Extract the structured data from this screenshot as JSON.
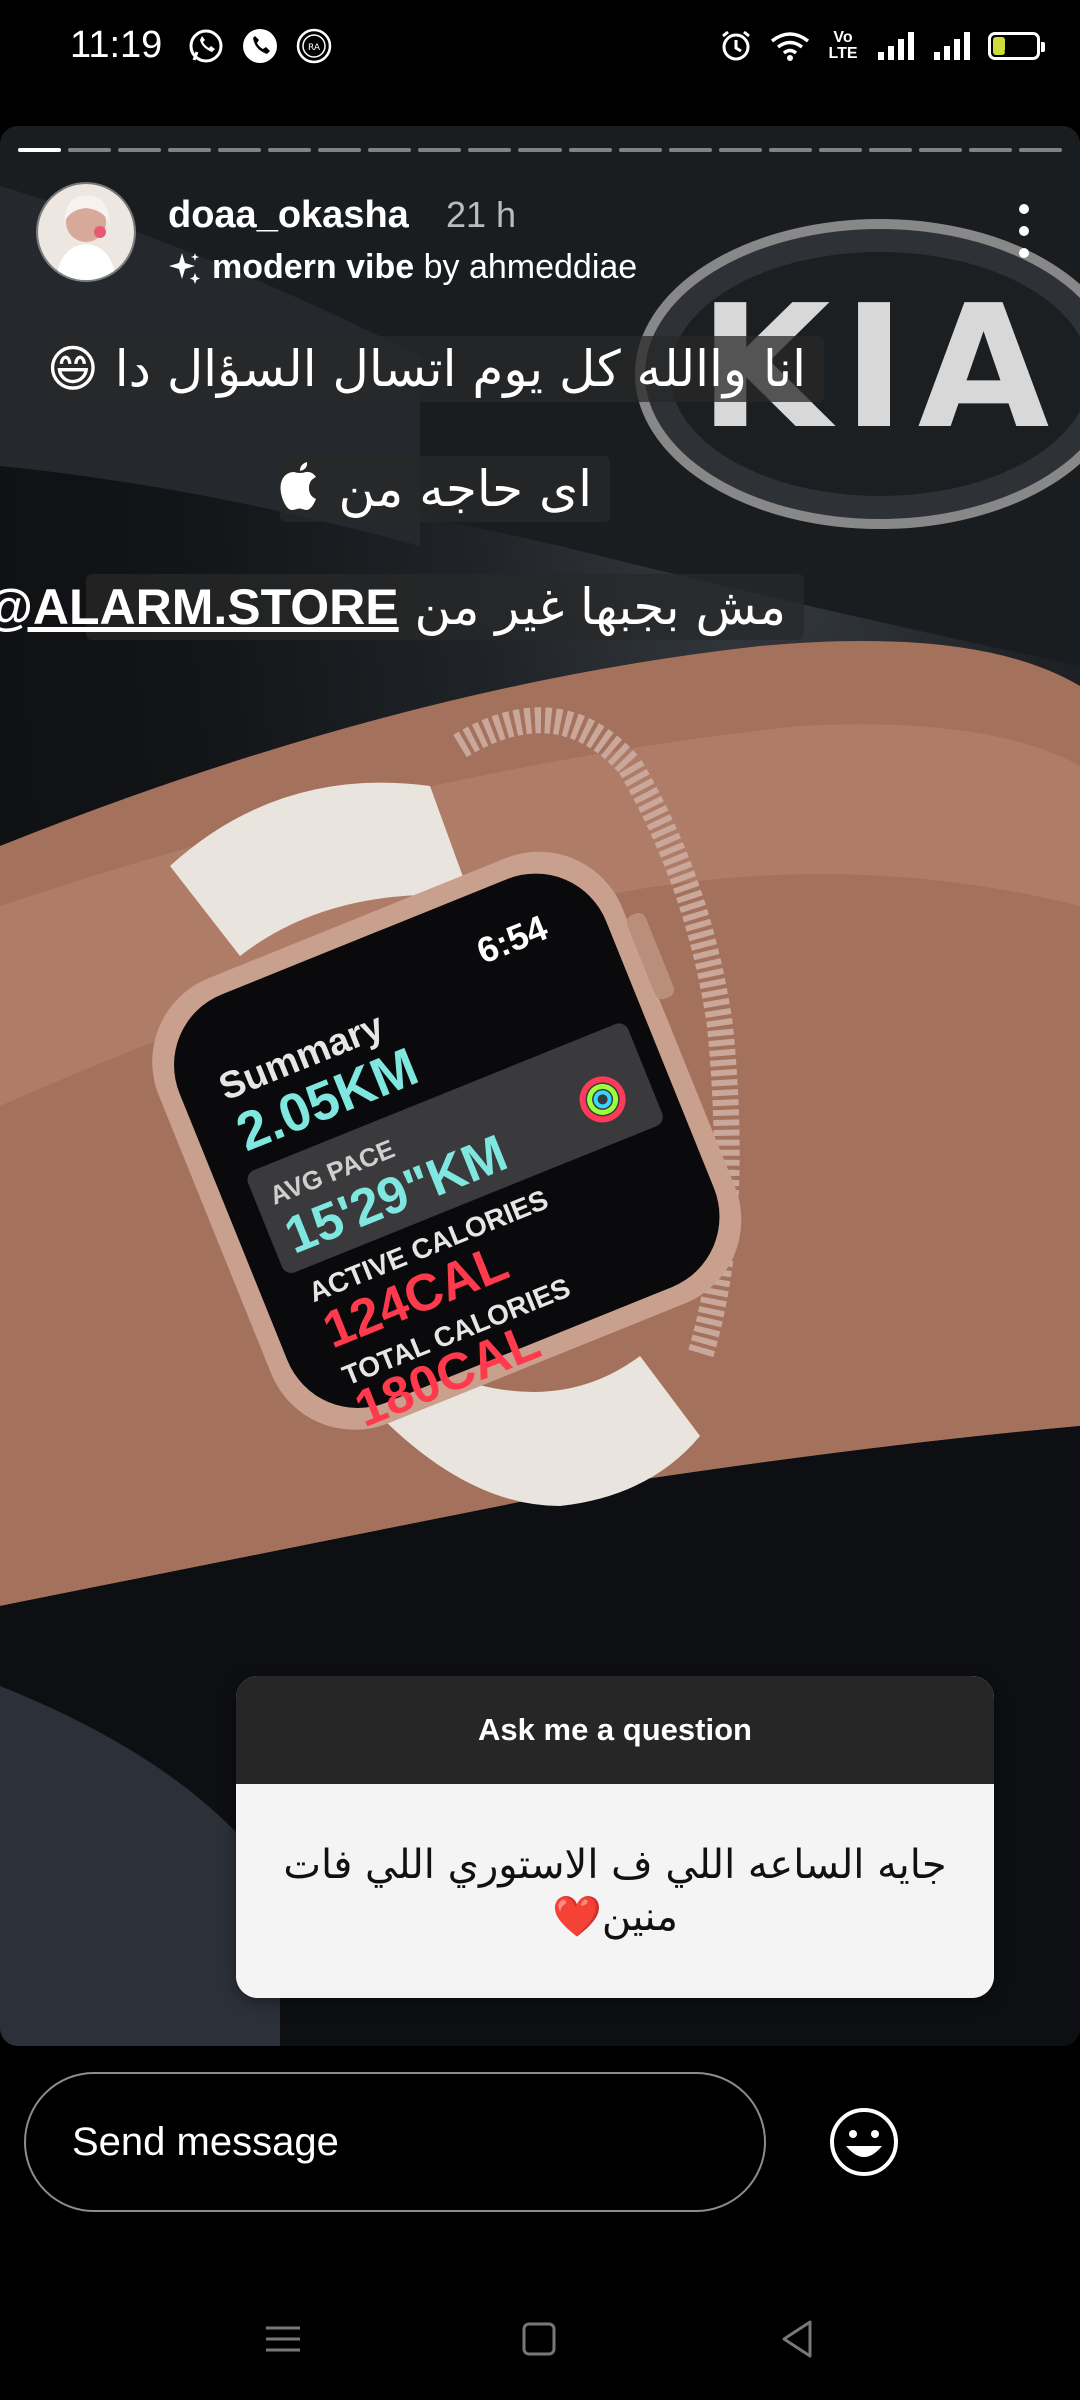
{
  "status_bar": {
    "time": "11:19",
    "battery": "25",
    "volte": "Vo\nLTE"
  },
  "story": {
    "segments_total": 21,
    "active_segment": 1,
    "username": "doaa_okasha",
    "time_ago": "21 h",
    "music_name": "modern vibe",
    "music_by": " by ahmeddiae",
    "captions": {
      "line1": "انا واالله كل يوم اتسال السؤال دا 😄",
      "line2": "اى حاجه من ",
      "line3_text": "مش بجبها غير من ",
      "line3_handle": "@ALARM.STORE"
    },
    "watch_screen": {
      "time": "6:54",
      "title": "Summary",
      "distance": "2.05KM",
      "pace_label": "AVG PACE",
      "pace": "15'29\"KM",
      "active_label": "ACTIVE CALORIES",
      "active": "124CAL",
      "total_label": "TOTAL CALORIES",
      "total": "180CAL"
    },
    "question": {
      "header": "Ask me a question",
      "body": "جايه الساعه اللي ف الاستوري اللي فات منين❤️"
    }
  },
  "reply": {
    "placeholder": "Send message"
  },
  "icons": {
    "more": "more-vertical-icon",
    "music": "sparkle-icon",
    "emoji": "smiley-icon",
    "apple": "apple-logo-icon"
  },
  "colors": {
    "background": "#000000",
    "question_header": "#262626",
    "question_body": "#f4f4f4",
    "battery_fill": "#cddc39"
  }
}
